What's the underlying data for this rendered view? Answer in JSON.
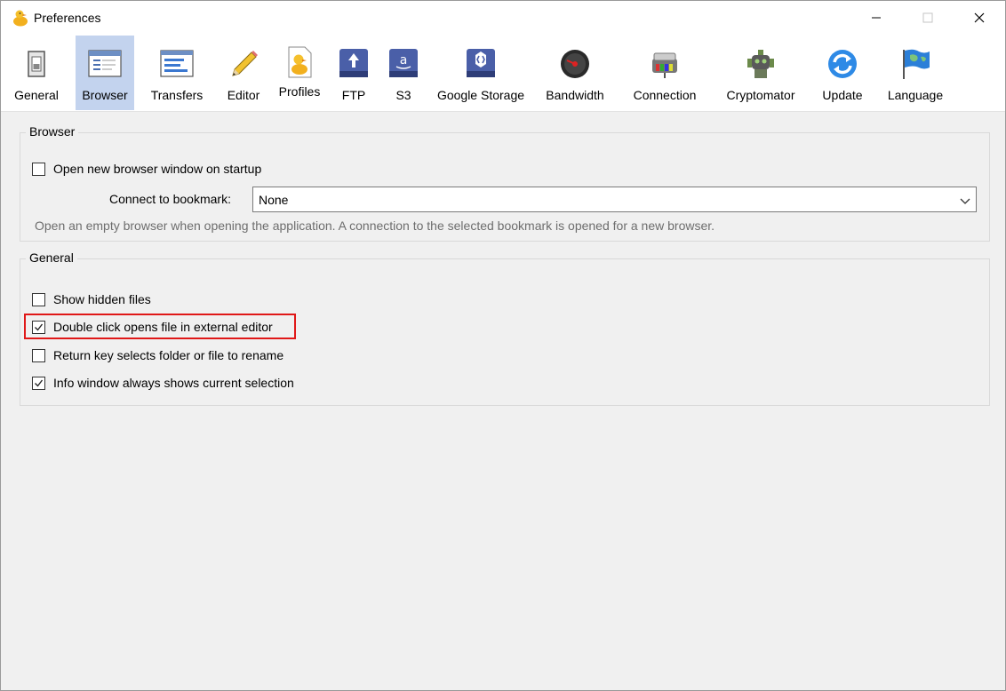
{
  "window": {
    "title": "Preferences"
  },
  "toolbar": {
    "items": [
      {
        "label": "General",
        "icon": "general-switch-icon"
      },
      {
        "label": "Browser",
        "icon": "browser-window-icon"
      },
      {
        "label": "Transfers",
        "icon": "transfers-list-icon"
      },
      {
        "label": "Editor",
        "icon": "pencil-icon"
      },
      {
        "label": "Profiles",
        "icon": "profiles-document-icon"
      },
      {
        "label": "FTP",
        "icon": "ftp-drive-icon"
      },
      {
        "label": "S3",
        "icon": "s3-amazon-drive-icon"
      },
      {
        "label": "Google Storage",
        "icon": "google-storage-drive-icon"
      },
      {
        "label": "Bandwidth",
        "icon": "bandwidth-gauge-icon"
      },
      {
        "label": "Connection",
        "icon": "connection-network-icon"
      },
      {
        "label": "Cryptomator",
        "icon": "cryptomator-robot-icon"
      },
      {
        "label": "Update",
        "icon": "update-sync-icon"
      },
      {
        "label": "Language",
        "icon": "language-flag-icon"
      }
    ],
    "selected": "Browser"
  },
  "browser_group": {
    "title": "Browser",
    "open_new_window": {
      "label": "Open new browser window on startup",
      "checked": false
    },
    "bookmark": {
      "label": "Connect to bookmark:",
      "value": "None"
    },
    "hint": "Open an empty browser when opening the application. A connection to the selected bookmark is opened for a new browser."
  },
  "general_group": {
    "title": "General",
    "options": [
      {
        "label": "Show hidden files",
        "checked": false
      },
      {
        "label": "Double click opens file in external editor",
        "checked": true
      },
      {
        "label": "Return key selects folder or file to rename",
        "checked": false
      },
      {
        "label": "Info window always shows current selection",
        "checked": true
      }
    ]
  },
  "colors": {
    "selected_tab": "#c3d3ee",
    "highlight": "#e01818"
  }
}
